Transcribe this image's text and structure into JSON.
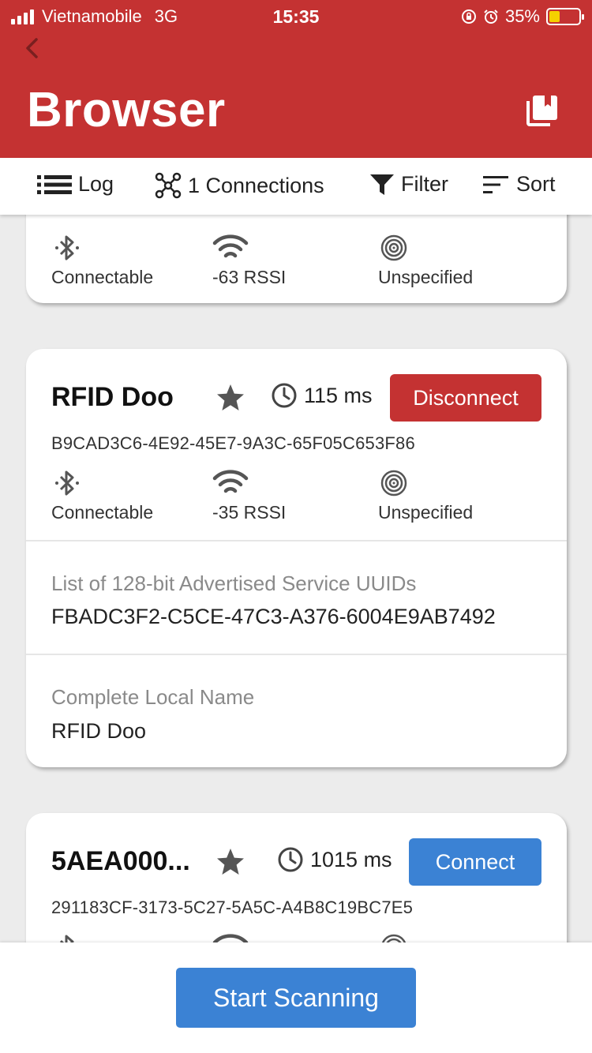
{
  "status_bar": {
    "carrier": "Vietnamobile",
    "network": "3G",
    "time": "15:35",
    "battery": "35%",
    "battery_level": 0.35
  },
  "header": {
    "title": "Browser"
  },
  "toolbar": {
    "log": "Log",
    "connections": "1 Connections",
    "filter": "Filter",
    "sort": "Sort"
  },
  "partial_card": {
    "connectable": "Connectable",
    "rssi": "-63 RSSI",
    "type": "Unspecified"
  },
  "device_card": {
    "name": "RFID Doo",
    "interval": "115 ms",
    "action": "Disconnect",
    "uuid": "B9CAD3C6-4E92-45E7-9A3C-65F05C653F86",
    "connectable": "Connectable",
    "rssi": "-35 RSSI",
    "type": "Unspecified",
    "sections": [
      {
        "title": "List of 128-bit Advertised Service UUIDs",
        "value": "FBADC3F2-C5CE-47C3-A376-6004E9AB7492"
      },
      {
        "title": "Complete Local Name",
        "value": "RFID Doo"
      }
    ]
  },
  "device_card_2": {
    "name": "5AEA000...",
    "interval": "1015 ms",
    "action": "Connect",
    "uuid": "291183CF-3173-5C27-5A5C-A4B8C19BC7E5"
  },
  "bottom": {
    "scan_button": "Start Scanning"
  },
  "colors": {
    "header_red": "#c43232",
    "disconnect_red": "#c43232",
    "connect_blue": "#3b82d4",
    "battery_yellow": "#f5d000"
  }
}
